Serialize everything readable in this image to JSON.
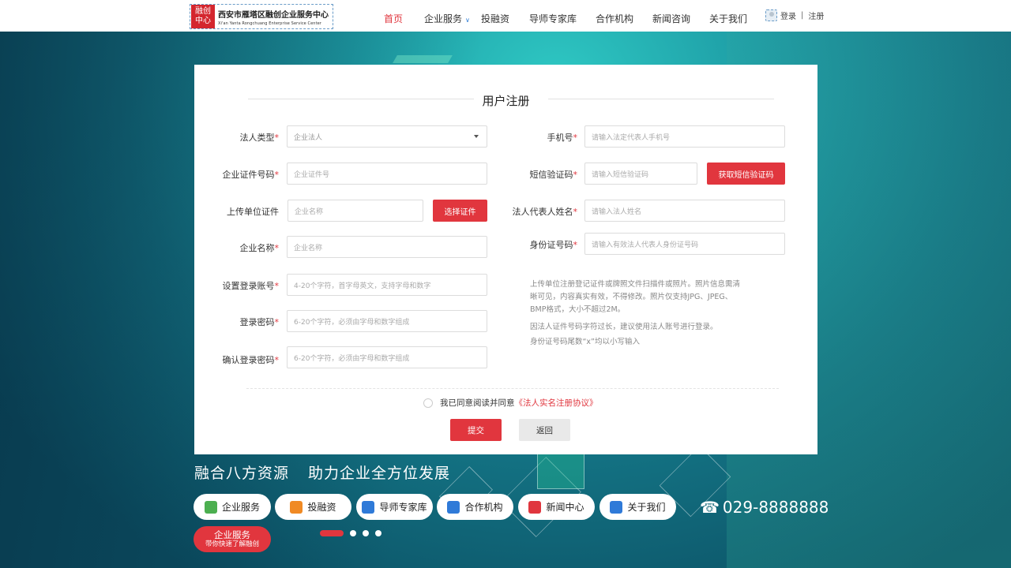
{
  "header": {
    "logo_seal": [
      "融创",
      "中心"
    ],
    "logo_title": "西安市雁塔区融创企业服务中心",
    "logo_subtitle": "Xi'an Yanta Rongchuang Enterprise Service Center",
    "nav": [
      "首页",
      "企业服务",
      "投融资",
      "导师专家库",
      "合作机构",
      "新闻咨询",
      "关于我们"
    ],
    "active_nav": "首页",
    "login": "登录",
    "separator": "|",
    "register": "注册"
  },
  "form": {
    "title": "用户注册",
    "required_mark": "*",
    "left": {
      "legal_type_label": "法人类型",
      "legal_type_value": "企业法人",
      "cert_no_label": "企业证件号码",
      "cert_no_placeholder": "企业证件号",
      "upload_label": "上传单位证件",
      "upload_placeholder": "企业名称",
      "upload_button": "选择证件",
      "company_name_label": "企业名称",
      "company_name_placeholder": "企业名称",
      "account_label": "设置登录账号",
      "account_placeholder": "4-20个字符，首字母英文，支持字母和数字",
      "password_label": "登录密码",
      "password_placeholder": "6-20个字符，必须由字母和数字组成",
      "confirm_label": "确认登录密码",
      "confirm_placeholder": "6-20个字符，必须由字母和数字组成"
    },
    "right": {
      "phone_label": "手机号",
      "phone_placeholder": "请输入法定代表人手机号",
      "sms_label": "短信验证码",
      "sms_placeholder": "请输入短信验证码",
      "sms_button": "获取短信验证码",
      "rep_name_label": "法人代表人姓名",
      "rep_name_placeholder": "请输入法人姓名",
      "id_label": "身份证号码",
      "id_placeholder": "请输入有效法人代表人身份证号码"
    },
    "hints": [
      "上传单位注册登记证件或牌照文件扫描件或照片。照片信息需清",
      "晰可见，内容真实有效，不得修改。照片仅支持JPG、JPEG、",
      "BMP格式，大小不超过2M。",
      "因法人证件号码字符过长，建议使用法人账号进行登录。",
      "身份证号码尾数“x”均以小写输入"
    ],
    "agree_text": "我已同意阅读并同意",
    "agree_link": "《法人实名注册协议》",
    "submit": "提交",
    "back": "返回"
  },
  "footer": {
    "slogan_left": "融合八方资源",
    "slogan_right": "助力企业全方位发展",
    "pills": [
      {
        "label": "企业服务",
        "icon": "grid-icon",
        "color": "#4caf50"
      },
      {
        "label": "投融资",
        "icon": "money-icon",
        "color": "#f08a24"
      },
      {
        "label": "导师专家库",
        "icon": "mentor-icon",
        "color": "#2f7ad8"
      },
      {
        "label": "合作机构",
        "icon": "handshake-icon",
        "color": "#2f7ad8"
      },
      {
        "label": "新闻中心",
        "icon": "news-icon",
        "color": "#e0363e"
      },
      {
        "label": "关于我们",
        "icon": "team-icon",
        "color": "#2f7ad8"
      }
    ],
    "phone": "029-8888888",
    "cta_title": "企业服务",
    "cta_subtitle": "带你快速了解融创",
    "carousel": {
      "total": 4,
      "active": 1
    }
  }
}
